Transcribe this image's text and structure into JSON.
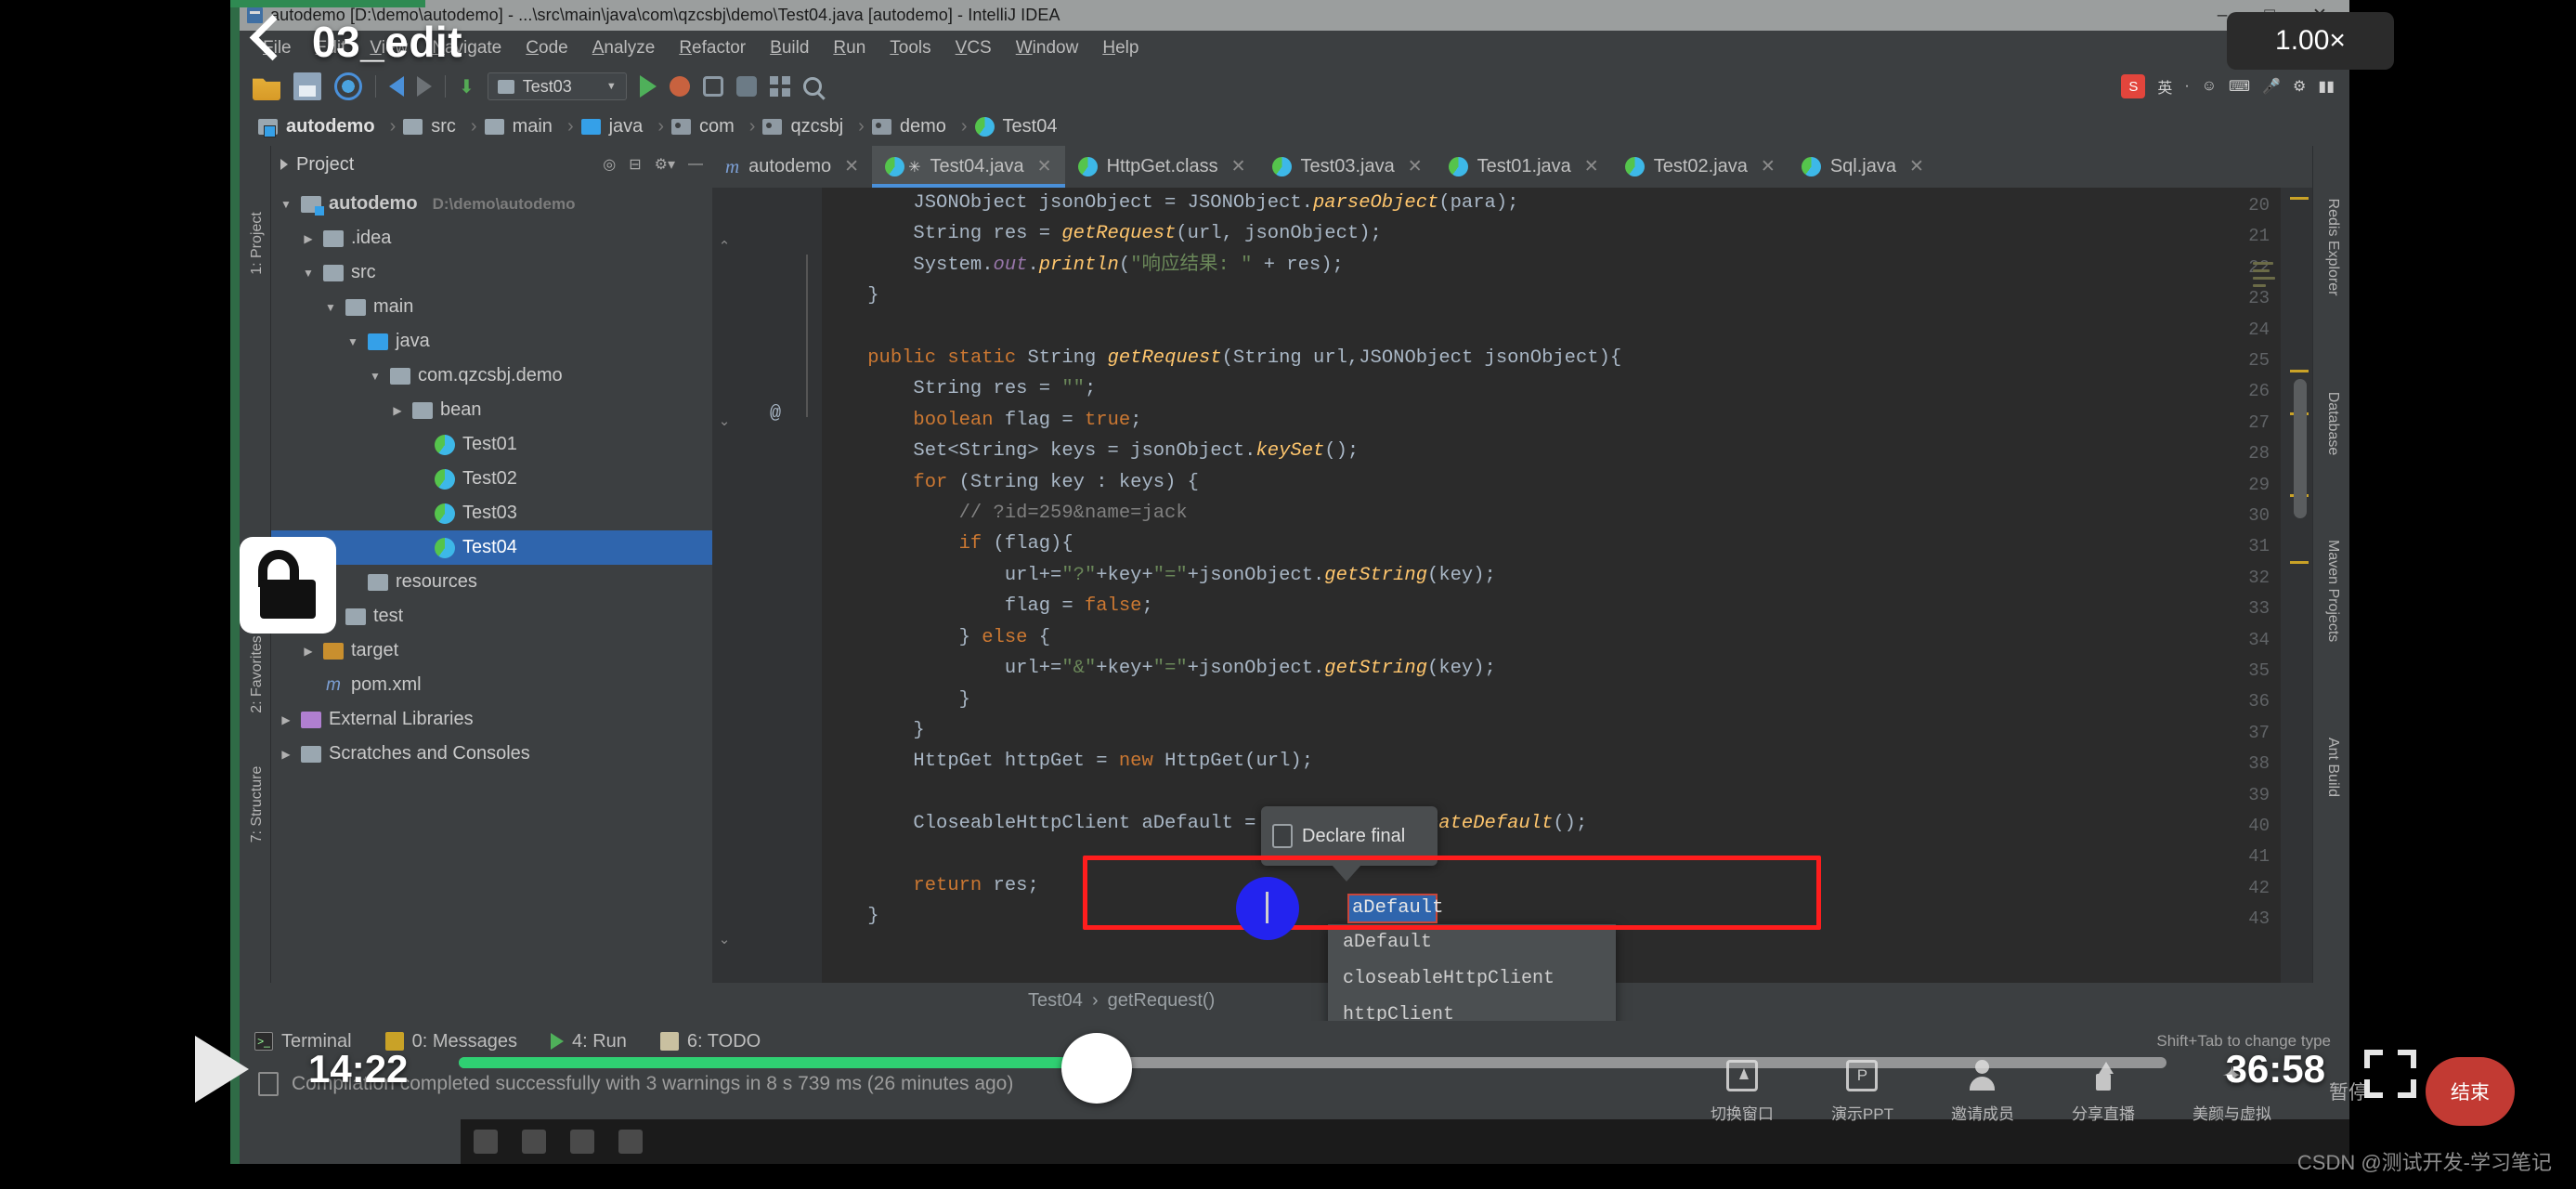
{
  "player": {
    "title": "03_edit",
    "speed_badge": "1.00×",
    "current_time": "14:22",
    "total_time": "36:58",
    "back_icon": "chevron-left-icon",
    "play_icon": "play-icon",
    "fullscreen_icon": "fullscreen-icon",
    "progress_percent": 39
  },
  "watermark": "CSDN @测试开发-学习笔记",
  "meeting_bar": {
    "items": [
      {
        "label": "切换窗口",
        "icon": "switch-window-icon"
      },
      {
        "label": "演示PPT",
        "icon": "ppt-icon"
      },
      {
        "label": "邀请成员",
        "icon": "invite-member-icon"
      },
      {
        "label": "分享直播",
        "icon": "share-live-icon"
      },
      {
        "label": "美颜与虚拟",
        "icon": "beauty-filter-icon"
      }
    ],
    "pause_label": "暂停",
    "end_label": "结束"
  },
  "ide": {
    "window_title": "autodemo [D:\\demo\\autodemo] - ...\\src\\main\\java\\com\\qzcsbj\\demo\\Test04.java [autodemo] - IntelliJ IDEA",
    "window_buttons": [
      "–",
      "□",
      "✕"
    ],
    "menu": [
      "File",
      "Edit",
      "View",
      "Navigate",
      "Code",
      "Analyze",
      "Refactor",
      "Build",
      "Run",
      "Tools",
      "VCS",
      "Window",
      "Help"
    ],
    "toolbar": {
      "run_config": "Test03",
      "icons": [
        "open-folder-icon",
        "save-all-icon",
        "sync-icon",
        "back-icon",
        "forward-icon",
        "compile-icon",
        "run-icon",
        "debug-icon",
        "coverage-icon",
        "profiler-icon",
        "layout-icon",
        "search-icon"
      ]
    },
    "tray": {
      "ime_label": "英",
      "icons": [
        "sogou-icon",
        "ime-icon",
        "emoji-icon",
        "keyboard-icon",
        "mic-icon",
        "tray-icon",
        "battery-icon"
      ]
    },
    "breadcrumbs": [
      {
        "label": "autodemo",
        "icon": "module-icon",
        "bold": true
      },
      {
        "label": "src",
        "icon": "folder-icon"
      },
      {
        "label": "main",
        "icon": "folder-icon"
      },
      {
        "label": "java",
        "icon": "source-folder-icon"
      },
      {
        "label": "com",
        "icon": "package-icon"
      },
      {
        "label": "qzcsbj",
        "icon": "package-icon"
      },
      {
        "label": "demo",
        "icon": "package-icon"
      },
      {
        "label": "Test04",
        "icon": "class-icon"
      }
    ],
    "left_strips": [
      "1: Project",
      "7: Structure",
      "2: Favorites"
    ],
    "right_strips": [
      "Redis Explorer",
      "Database",
      "Maven Projects",
      "Ant Build"
    ],
    "project_panel": {
      "title": "Project",
      "header_icons": [
        "target-icon",
        "collapse-icon",
        "settings-icon",
        "hide-icon"
      ],
      "tree": [
        {
          "label": "autodemo",
          "sub": "D:\\demo\\autodemo",
          "icon": "module-icon",
          "indent": 0,
          "arrow": "▼",
          "bold": true
        },
        {
          "label": ".idea",
          "icon": "folder-icon",
          "indent": 1,
          "arrow": "▶"
        },
        {
          "label": "src",
          "icon": "folder-icon",
          "indent": 1,
          "arrow": "▼"
        },
        {
          "label": "main",
          "icon": "folder-icon",
          "indent": 2,
          "arrow": "▼"
        },
        {
          "label": "java",
          "icon": "source-folder-icon",
          "indent": 3,
          "arrow": "▼"
        },
        {
          "label": "com.qzcsbj.demo",
          "icon": "package-icon",
          "indent": 4,
          "arrow": "▼"
        },
        {
          "label": "bean",
          "icon": "package-icon",
          "indent": 5,
          "arrow": "▶"
        },
        {
          "label": "Test01",
          "icon": "class-icon",
          "indent": 6,
          "arrow": ""
        },
        {
          "label": "Test02",
          "icon": "class-icon",
          "indent": 6,
          "arrow": ""
        },
        {
          "label": "Test03",
          "icon": "class-icon",
          "indent": 6,
          "arrow": ""
        },
        {
          "label": "Test04",
          "icon": "class-icon",
          "indent": 6,
          "arrow": "",
          "selected": true
        },
        {
          "label": "resources",
          "icon": "folder-icon",
          "indent": 3,
          "arrow": ""
        },
        {
          "label": "test",
          "icon": "folder-icon",
          "indent": 2,
          "arrow": "▶"
        },
        {
          "label": "target",
          "icon": "target-folder-icon",
          "indent": 1,
          "arrow": "▶"
        },
        {
          "label": "pom.xml",
          "icon": "maven-xml-icon",
          "indent": 1,
          "arrow": ""
        },
        {
          "label": "External Libraries",
          "icon": "libraries-icon",
          "indent": 0,
          "arrow": "▶"
        },
        {
          "label": "Scratches and Consoles",
          "icon": "scratches-icon",
          "indent": 0,
          "arrow": "▶"
        }
      ]
    },
    "editor_tabs": [
      {
        "label": "autodemo",
        "icon": "maven-icon",
        "active": false,
        "modified": false
      },
      {
        "label": "Test04.java",
        "icon": "class-icon",
        "active": true,
        "modified": true
      },
      {
        "label": "HttpGet.class",
        "icon": "class-readonly-icon",
        "active": false,
        "modified": false
      },
      {
        "label": "Test03.java",
        "icon": "class-icon",
        "active": false,
        "modified": false
      },
      {
        "label": "Test01.java",
        "icon": "class-icon",
        "active": false,
        "modified": false
      },
      {
        "label": "Test02.java",
        "icon": "class-icon",
        "active": false,
        "modified": false
      },
      {
        "label": "Sql.java",
        "icon": "class-icon",
        "active": false,
        "modified": false
      }
    ],
    "code_lines": [
      {
        "no": 20,
        "text": "        JSONObject jsonObject = JSONObject.parseObject(para);"
      },
      {
        "no": 21,
        "text": "        String res = getRequest(url, jsonObject);"
      },
      {
        "no": 22,
        "text": "        System.out.println(\"响应结果: \" + res);"
      },
      {
        "no": 23,
        "text": "    }"
      },
      {
        "no": 24,
        "text": ""
      },
      {
        "no": 25,
        "text": "    public static String getRequest(String url,JSONObject jsonObject){"
      },
      {
        "no": 26,
        "text": "        String res = \"\";"
      },
      {
        "no": 27,
        "text": "        boolean flag = true;"
      },
      {
        "no": 28,
        "text": "        Set<String> keys = jsonObject.keySet();"
      },
      {
        "no": 29,
        "text": "        for (String key : keys) {"
      },
      {
        "no": 30,
        "text": "            // ?id=259&name=jack"
      },
      {
        "no": 31,
        "text": "            if (flag){"
      },
      {
        "no": 32,
        "text": "                url+=\"?\"+key+\"=\"+jsonObject.getString(key);"
      },
      {
        "no": 33,
        "text": "                flag = false;"
      },
      {
        "no": 34,
        "text": "            } else {"
      },
      {
        "no": 35,
        "text": "                url+=\"&\"+key+\"=\"+jsonObject.getString(key);"
      },
      {
        "no": 36,
        "text": "            }"
      },
      {
        "no": 37,
        "text": "        }"
      },
      {
        "no": 38,
        "text": "        HttpGet httpGet = new HttpGet(url);"
      },
      {
        "no": 39,
        "text": ""
      },
      {
        "no": 40,
        "text": "        CloseableHttpClient aDefault = HttpClients.createDefault();"
      },
      {
        "no": 41,
        "text": ""
      },
      {
        "no": 42,
        "text": "        return res;"
      },
      {
        "no": 43,
        "text": "    }"
      }
    ],
    "intention_tooltip": {
      "label": "Declare final",
      "underline_char": "f"
    },
    "completion_items": [
      "aDefault",
      "closeableHttpClient",
      "httpClient"
    ],
    "selected_token": "aDefault",
    "completion_hint": "Shift+Tab to change type",
    "editor_breadcrumb": [
      "Test04",
      "getRequest()"
    ],
    "bottom_tool_windows": [
      {
        "label": "Terminal",
        "icon": "terminal-icon",
        "num": ""
      },
      {
        "label": "0: Messages",
        "icon": "messages-icon",
        "num": "0"
      },
      {
        "label": "4: Run",
        "icon": "run-icon",
        "num": "4"
      },
      {
        "label": "6: TODO",
        "icon": "todo-icon",
        "num": "6"
      }
    ],
    "status_message": "Compilation completed successfully with 3 warnings in 8 s 739 ms (26 minutes ago)"
  }
}
